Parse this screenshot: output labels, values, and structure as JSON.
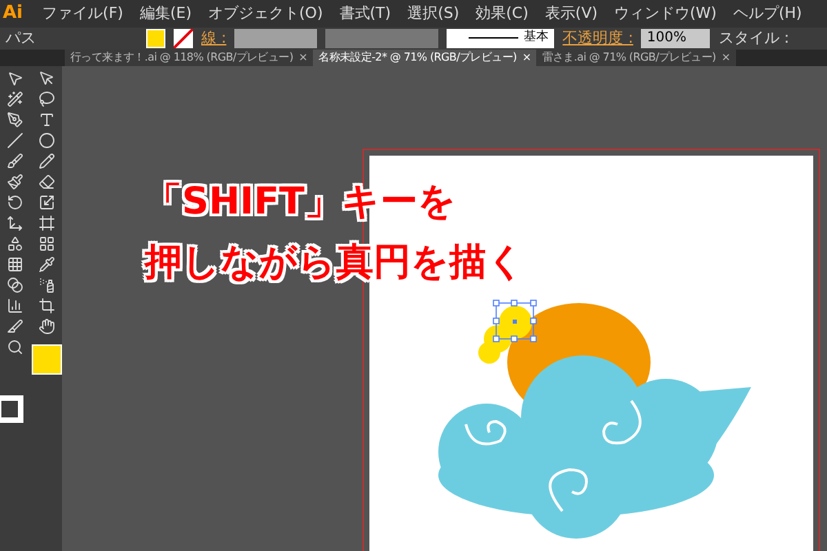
{
  "menu": {
    "logo": "Ai",
    "items": [
      "ファイル(F)",
      "編集(E)",
      "オブジェクト(O)",
      "書式(T)",
      "選択(S)",
      "効果(C)",
      "表示(V)",
      "ウィンドウ(W)",
      "ヘルプ(H)"
    ]
  },
  "control_bar": {
    "selection": "パス",
    "stroke_label": "線 :",
    "stroke_preset": "基本",
    "opacity_label": "不透明度 :",
    "opacity": "100%",
    "style_label": "スタイル :"
  },
  "tabs": [
    {
      "label": "行って来ます！.ai @ 118% (RGB/プレビュー)",
      "close": "×",
      "selected": false
    },
    {
      "label": "名称未設定-2* @ 71% (RGB/プレビュー)",
      "close": "×",
      "selected": true
    },
    {
      "label": "雷さま.ai @ 71% (RGB/プレビュー)",
      "close": "×",
      "selected": false
    }
  ],
  "overlay": {
    "lines": [
      "「SHIFT」キーを",
      "押しながら真円を描く"
    ]
  }
}
